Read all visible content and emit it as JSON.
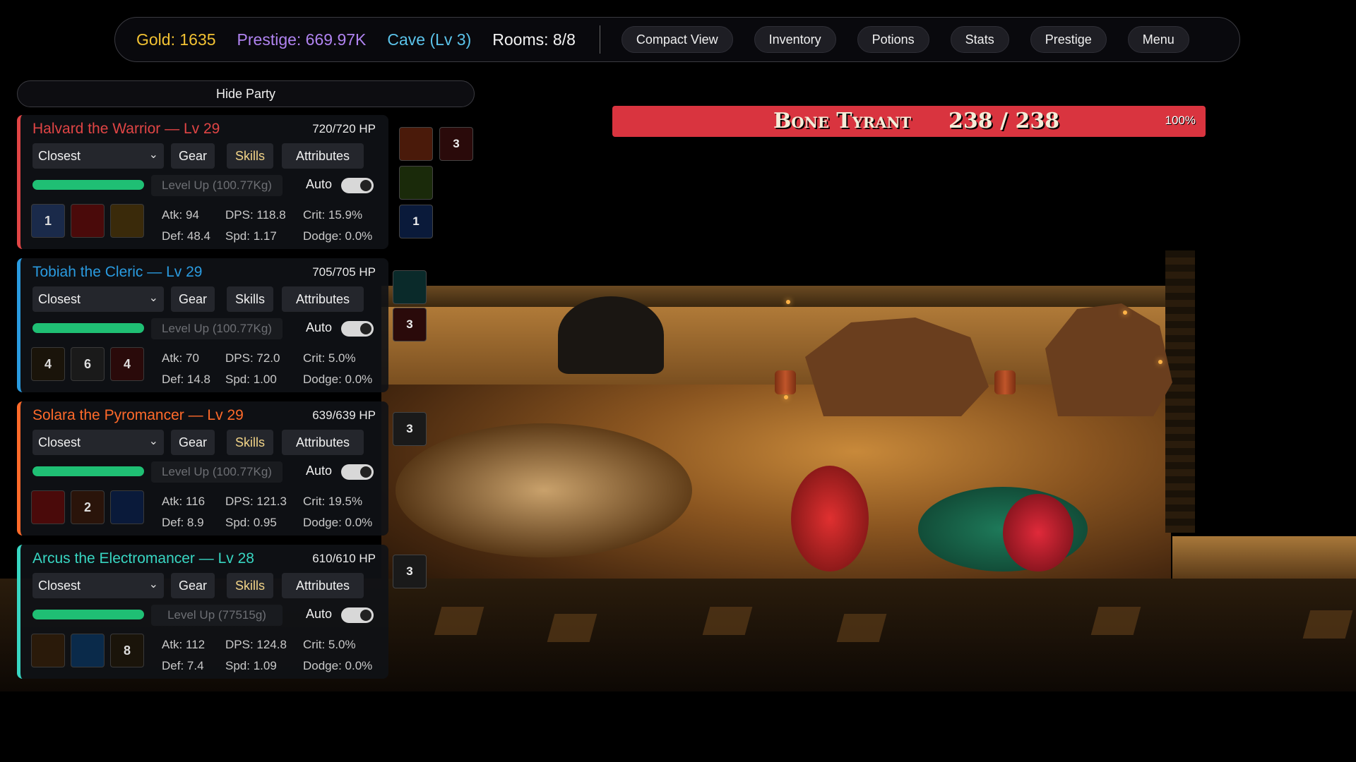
{
  "hud": {
    "gold": "Gold: 1635",
    "prestige": "Prestige: 669.97K",
    "zone": "Cave (Lv 3)",
    "rooms": "Rooms: 8/8",
    "buttons": [
      "Compact View",
      "Inventory",
      "Potions",
      "Stats",
      "Prestige",
      "Menu"
    ]
  },
  "party": {
    "hide_label": "Hide Party",
    "heroes": [
      {
        "name": "Halvard the Warrior — Lv 29",
        "hp": "720/720 HP",
        "target": "Closest",
        "gear": "Gear",
        "skills": "Skills",
        "attributes": "Attributes",
        "level_up": "Level Up (100.77Kg)",
        "auto": "Auto",
        "auto_enabled": true,
        "xp_fraction": 1.0,
        "skill_badges": [
          "1",
          "",
          ""
        ],
        "atk": "Atk: 94",
        "dps": "DPS: 118.8",
        "crit": "Crit: 15.9%",
        "def": "Def: 48.4",
        "spd": "Spd: 1.17",
        "dodge": "Dodge: 0.0%",
        "color": "#e04545",
        "skills_highlight": true
      },
      {
        "name": "Tobiah the Cleric — Lv 29",
        "hp": "705/705 HP",
        "target": "Closest",
        "gear": "Gear",
        "skills": "Skills",
        "attributes": "Attributes",
        "level_up": "Level Up (100.77Kg)",
        "auto": "Auto",
        "auto_enabled": true,
        "xp_fraction": 1.0,
        "skill_badges": [
          "4",
          "6",
          "4"
        ],
        "atk": "Atk: 70",
        "dps": "DPS: 72.0",
        "crit": "Crit: 5.0%",
        "def": "Def: 14.8",
        "spd": "Spd: 1.00",
        "dodge": "Dodge: 0.0%",
        "color": "#2a9be0",
        "skills_highlight": false
      },
      {
        "name": "Solara the Pyromancer — Lv 29",
        "hp": "639/639 HP",
        "target": "Closest",
        "gear": "Gear",
        "skills": "Skills",
        "attributes": "Attributes",
        "level_up": "Level Up (100.77Kg)",
        "auto": "Auto",
        "auto_enabled": true,
        "xp_fraction": 1.0,
        "skill_badges": [
          "",
          "2",
          ""
        ],
        "atk": "Atk: 116",
        "dps": "DPS: 121.3",
        "crit": "Crit: 19.5%",
        "def": "Def: 8.9",
        "spd": "Spd: 0.95",
        "dodge": "Dodge: 0.0%",
        "color": "#ff6a2a",
        "skills_highlight": true
      },
      {
        "name": "Arcus the Electromancer — Lv 28",
        "hp": "610/610 HP",
        "target": "Closest",
        "gear": "Gear",
        "skills": "Skills",
        "attributes": "Attributes",
        "level_up": "Level Up (77515g)",
        "auto": "Auto",
        "auto_enabled": true,
        "xp_fraction": 1.0,
        "skill_badges": [
          "",
          "",
          "8"
        ],
        "atk": "Atk: 112",
        "dps": "DPS: 124.8",
        "crit": "Crit: 5.0%",
        "def": "Def: 7.4",
        "spd": "Spd: 1.09",
        "dodge": "Dodge: 0.0%",
        "color": "#38d6c2",
        "skills_highlight": true
      }
    ]
  },
  "buffs": {
    "halvard": [
      "",
      "3",
      "",
      "1"
    ],
    "tobiah": [
      "",
      "3"
    ],
    "solara": [
      "3"
    ],
    "arcus": [
      "3"
    ]
  },
  "boss": {
    "name": "Bone Tyrant",
    "hp": "238 / 238",
    "percent": "100%",
    "hp_fraction": 1.0,
    "bar_color": "#d9343f"
  }
}
